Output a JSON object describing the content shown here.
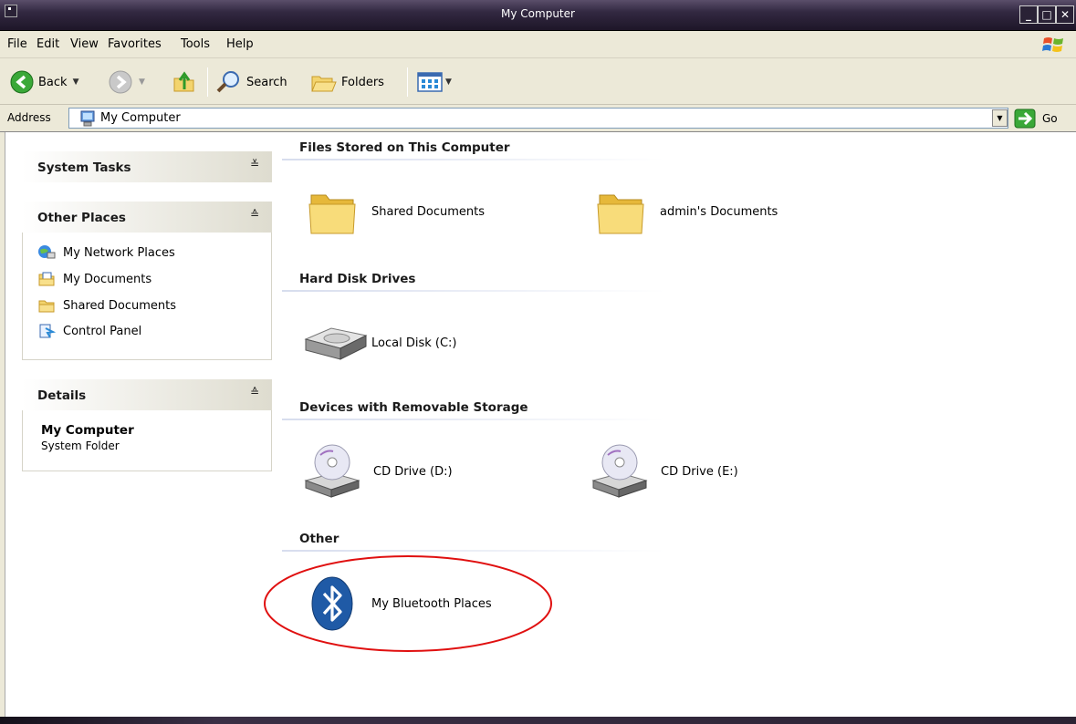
{
  "window": {
    "title": "My Computer"
  },
  "menu": [
    "File",
    "Edit",
    "View",
    "Favorites",
    "Tools",
    "Help"
  ],
  "toolbar": {
    "back": "Back",
    "search": "Search",
    "folders": "Folders"
  },
  "address": {
    "label": "Address",
    "value": "My Computer",
    "go": "Go"
  },
  "tasks": {
    "system_tasks": {
      "title": "System Tasks"
    },
    "other_places": {
      "title": "Other Places",
      "items": [
        "My Network Places",
        "My Documents",
        "Shared Documents",
        "Control Panel"
      ]
    },
    "details": {
      "title": "Details",
      "name": "My Computer",
      "type": "System Folder"
    }
  },
  "groups": [
    {
      "title": "Files Stored on This Computer",
      "items": [
        "Shared Documents",
        "admin's Documents"
      ]
    },
    {
      "title": "Hard Disk Drives",
      "items": [
        "Local Disk (C:)"
      ]
    },
    {
      "title": "Devices with Removable Storage",
      "items": [
        "CD Drive (D:)",
        "CD Drive (E:)"
      ]
    },
    {
      "title": "Other",
      "items": [
        "My Bluetooth Places"
      ]
    }
  ],
  "icons": {
    "folder": "folder-icon",
    "disk": "hard-disk-icon",
    "cd": "cd-drive-icon",
    "bluetooth": "bluetooth-icon",
    "highlight_color": "#e01010"
  }
}
